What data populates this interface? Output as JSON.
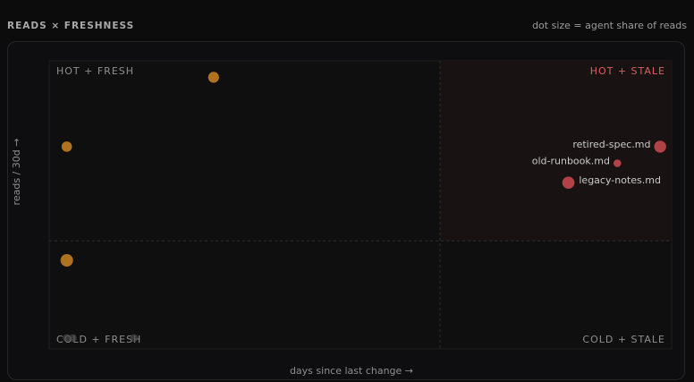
{
  "header": {
    "title": "READS × FRESHNESS",
    "note": "dot size = agent share of reads"
  },
  "colors": {
    "fresh": "#c07d22",
    "stale": "#c4484d",
    "cold": "#4a4a4a",
    "hot_stale_fill": "#181312",
    "hot_stale_label": "#d9605f",
    "quad_label": "#8e8e8e"
  },
  "chart_data": {
    "type": "scatter",
    "title": "READS × FRESHNESS",
    "xlabel": "days since last change →",
    "ylabel": "reads / 30d →",
    "size_legend": "dot size = agent share of reads",
    "grid": false,
    "quadrants": {
      "hot_fresh": "HOT + FRESH",
      "hot_stale": "HOT + STALE",
      "cold_fresh": "COLD + FRESH",
      "cold_stale": "COLD + STALE"
    },
    "xlim": [
      0,
      100
    ],
    "ylim": [
      0,
      100
    ],
    "threshold": {
      "x": 63,
      "y": 37
    },
    "points": [
      {
        "x": 26,
        "y": 96,
        "size": 0.6,
        "group": "fresh",
        "label": ""
      },
      {
        "x": 2,
        "y": 71,
        "size": 0.55,
        "group": "fresh",
        "label": ""
      },
      {
        "x": 2,
        "y": 30,
        "size": 0.75,
        "group": "fresh",
        "label": ""
      },
      {
        "x": 2,
        "y": 2,
        "size": 0.3,
        "group": "cold",
        "label": ""
      },
      {
        "x": 3,
        "y": 2,
        "size": 0.3,
        "group": "cold",
        "label": ""
      },
      {
        "x": 13,
        "y": 2,
        "size": 0.3,
        "group": "cold",
        "label": ""
      },
      {
        "x": 99,
        "y": 71,
        "size": 0.7,
        "group": "stale",
        "label": "retired-spec.md"
      },
      {
        "x": 92,
        "y": 65,
        "size": 0.3,
        "group": "stale",
        "label": "old-runbook.md"
      },
      {
        "x": 84,
        "y": 58,
        "size": 0.72,
        "group": "stale",
        "label": "legacy-notes.md"
      }
    ]
  }
}
